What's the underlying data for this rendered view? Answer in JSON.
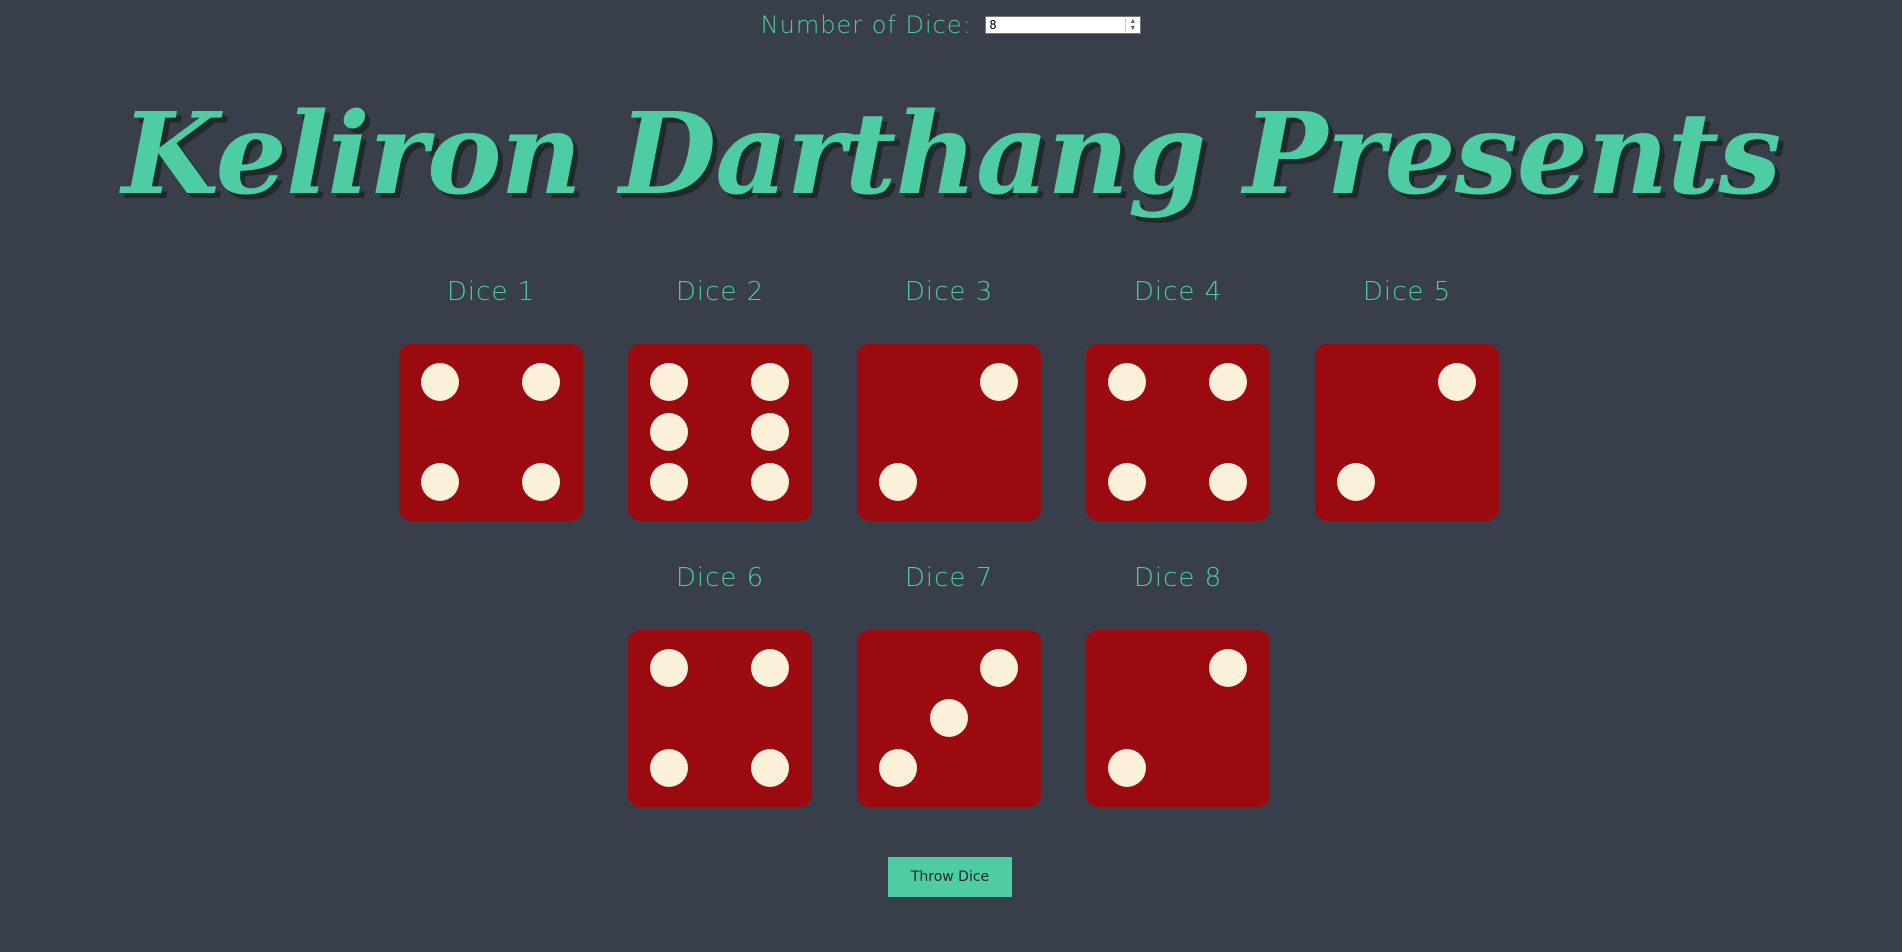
{
  "controls": {
    "label": "Number of Dice:",
    "dice_count_value": "8",
    "spin_up": "▲",
    "spin_down": "▼"
  },
  "title": "Keliron Darthang Presents",
  "dice": [
    {
      "label": "Dice 1",
      "value": 4
    },
    {
      "label": "Dice 2",
      "value": 6
    },
    {
      "label": "Dice 3",
      "value": 2
    },
    {
      "label": "Dice 4",
      "value": 4
    },
    {
      "label": "Dice 5",
      "value": 2
    },
    {
      "label": "Dice 6",
      "value": 4
    },
    {
      "label": "Dice 7",
      "value": 3
    },
    {
      "label": "Dice 8",
      "value": 2
    }
  ],
  "throw_button": {
    "label": "Throw Dice"
  },
  "colors": {
    "background": "#393f4a",
    "accent": "#4ecca3",
    "die_face": "#9b0a0f",
    "pip": "#fbf0d8"
  }
}
